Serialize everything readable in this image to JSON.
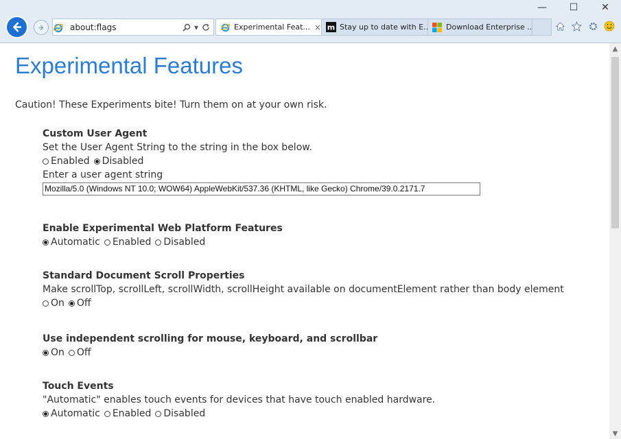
{
  "window": {
    "minimize": "—",
    "maximize": "☐",
    "close": "✕"
  },
  "address_bar": {
    "url": "about:flags"
  },
  "tabs": [
    {
      "label": "Experimental Feat...",
      "close": "×",
      "active": true
    },
    {
      "label": "Stay up to date with E...",
      "active": false
    },
    {
      "label": "Download Enterprise ...",
      "active": false
    }
  ],
  "page": {
    "title": "Experimental Features",
    "caution": "Caution! These Experiments bite! Turn them on at your own risk.",
    "sections": {
      "ua": {
        "title": "Custom User Agent",
        "desc": "Set the User Agent String to the string in the box below.",
        "options": [
          "Enabled",
          "Disabled"
        ],
        "selected": "Disabled",
        "input_label": "Enter a user agent string",
        "input_value": "Mozilla/5.0 (Windows NT 10.0; WOW64) AppleWebKit/537.36 (KHTML, like Gecko) Chrome/39.0.2171.7"
      },
      "web_platform": {
        "title": "Enable Experimental Web Platform Features",
        "options": [
          "Automatic",
          "Enabled",
          "Disabled"
        ],
        "selected": "Automatic"
      },
      "scroll_props": {
        "title": "Standard Document Scroll Properties",
        "desc": "Make scrollTop, scrollLeft, scrollWidth, scrollHeight available on documentElement rather than body element",
        "options": [
          "On",
          "Off"
        ],
        "selected": "Off"
      },
      "indep_scroll": {
        "title": "Use independent scrolling for mouse, keyboard, and scrollbar",
        "options": [
          "On",
          "Off"
        ],
        "selected": "On"
      },
      "touch": {
        "title": "Touch Events",
        "desc": "\"Automatic\" enables touch events for devices that have touch enabled hardware.",
        "options": [
          "Automatic",
          "Enabled",
          "Disabled"
        ],
        "selected": "Automatic"
      }
    }
  },
  "colors": {
    "title": "#2b7cd3",
    "back_button": "#1e6fd4",
    "chrome": "#e3ebf5"
  },
  "icons": [
    "back-arrow-icon",
    "forward-arrow-icon",
    "ie-logo-icon",
    "search-icon",
    "dropdown-icon",
    "refresh-icon",
    "medium-m-icon",
    "windows-logo-icon",
    "home-icon",
    "favorites-star-icon",
    "settings-gear-icon",
    "smiley-icon"
  ]
}
